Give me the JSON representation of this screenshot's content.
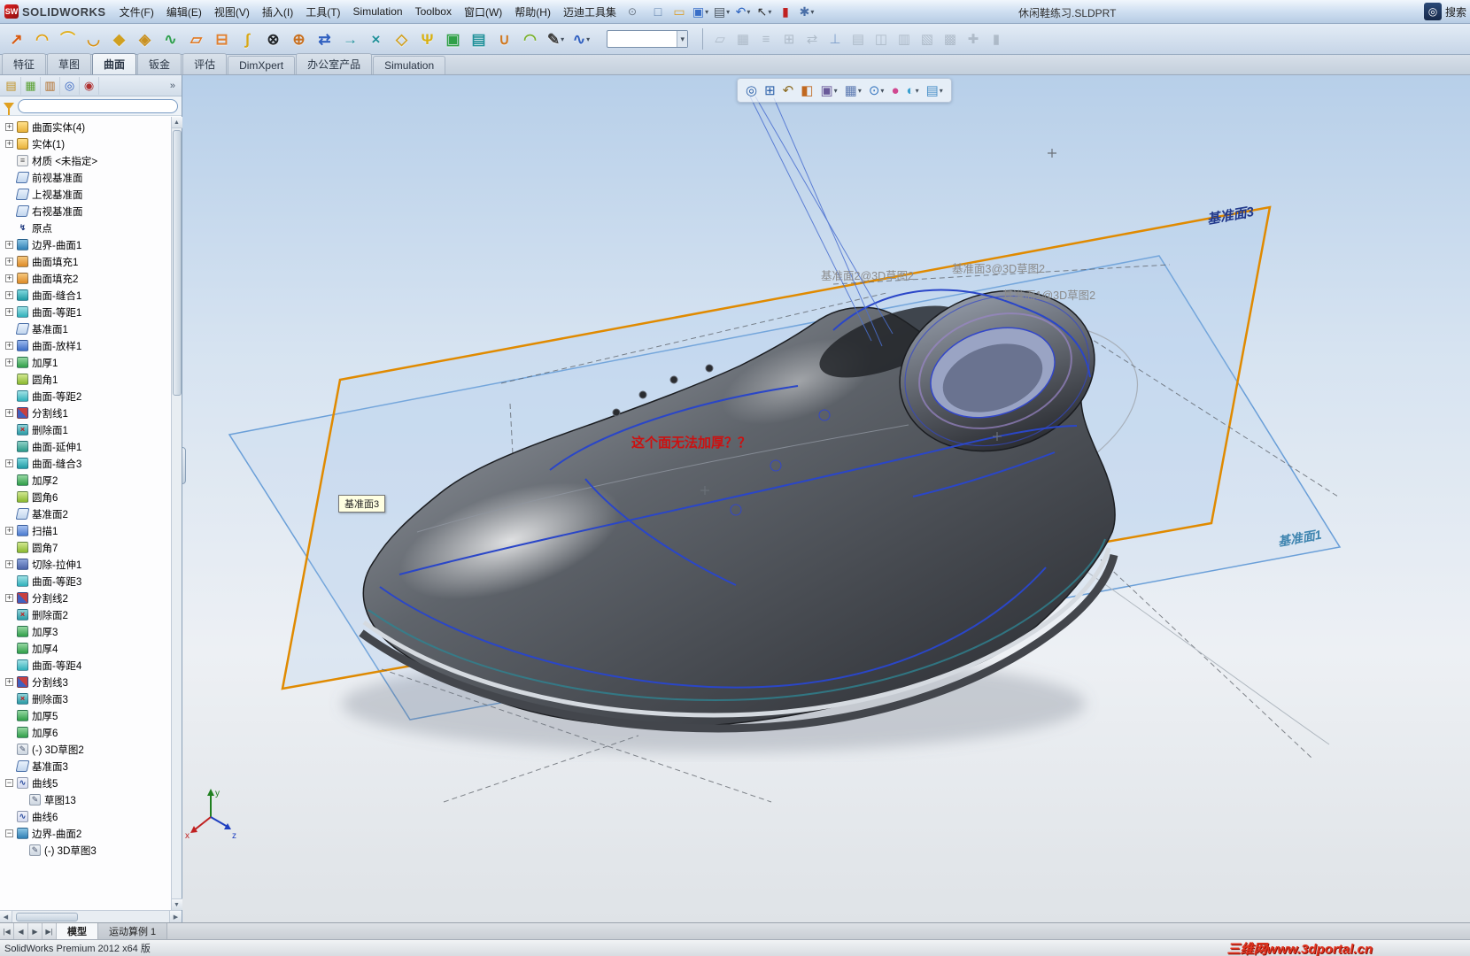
{
  "window": {
    "brand": "SOLIDWORKS",
    "title": "休闲鞋练习.SLDPRT",
    "search_label": "搜索"
  },
  "menubar": {
    "items": [
      "文件(F)",
      "编辑(E)",
      "视图(V)",
      "插入(I)",
      "工具(T)",
      "Simulation",
      "Toolbox",
      "窗口(W)",
      "帮助(H)",
      "迈迪工具集"
    ]
  },
  "quick_toolbar": {
    "icons": [
      {
        "name": "new-document-icon",
        "glyph": "□",
        "c": "#5a7ca8",
        "dd": false
      },
      {
        "name": "open-icon",
        "glyph": "▭",
        "c": "#d8a030",
        "dd": false
      },
      {
        "name": "save-icon",
        "glyph": "▣",
        "c": "#3a6fc8",
        "dd": true
      },
      {
        "name": "print-icon",
        "glyph": "▤",
        "c": "#4a5560",
        "dd": true
      },
      {
        "name": "undo-icon",
        "glyph": "↶",
        "c": "#2a62c0",
        "dd": true
      },
      {
        "name": "select-icon",
        "glyph": "↖",
        "c": "#303030",
        "dd": true
      },
      {
        "name": "rebuild-icon",
        "glyph": "▮",
        "c": "#c02020",
        "dd": false
      },
      {
        "name": "options-icon",
        "glyph": "✱",
        "c": "#4a6fa8",
        "dd": true
      }
    ]
  },
  "surface_toolbar": {
    "icons": [
      {
        "name": "surface-extrude-icon",
        "glyph": "↗",
        "c": "#d85a10",
        "dd": false
      },
      {
        "name": "surface-revolve-icon",
        "glyph": "◠",
        "c": "#e0a010",
        "dd": false
      },
      {
        "name": "surface-sweep-icon",
        "glyph": "⌒",
        "c": "#e0b020",
        "dd": false
      },
      {
        "name": "surface-loft-icon",
        "glyph": "◡",
        "c": "#d89010",
        "dd": false
      },
      {
        "name": "boundary-surface-icon",
        "glyph": "◆",
        "c": "#d0a020",
        "dd": false
      },
      {
        "name": "filled-surface-icon",
        "glyph": "◈",
        "c": "#c89020",
        "dd": false
      },
      {
        "name": "freeform-icon",
        "glyph": "∿",
        "c": "#30a050",
        "dd": false
      },
      {
        "name": "planar-surface-icon",
        "glyph": "▱",
        "c": "#e07820",
        "dd": false
      },
      {
        "name": "offset-surface-icon",
        "glyph": "⊟",
        "c": "#e08030",
        "dd": false
      },
      {
        "name": "ruled-surface-icon",
        "glyph": "∫",
        "c": "#d8a818",
        "dd": false
      },
      {
        "name": "delete-hole-icon",
        "glyph": "⊗",
        "c": "#202428",
        "dd": false
      },
      {
        "name": "replace-face-icon",
        "glyph": "⊕",
        "c": "#c87020",
        "dd": false
      },
      {
        "name": "move-face-icon",
        "glyph": "⇄",
        "c": "#3060c0",
        "dd": false
      },
      {
        "name": "extend-surface-icon",
        "glyph": "→",
        "c": "#20909a",
        "dd": false
      },
      {
        "name": "trim-surface-icon",
        "glyph": "×",
        "c": "#20909a",
        "dd": false
      },
      {
        "name": "untrim-surface-icon",
        "glyph": "◇",
        "c": "#d0a020",
        "dd": false
      },
      {
        "name": "knit-surface-icon",
        "glyph": "Ψ",
        "c": "#d8b010",
        "dd": false
      },
      {
        "name": "thicken-icon",
        "glyph": "▣",
        "c": "#30a048",
        "dd": false
      },
      {
        "name": "thickened-cut-icon",
        "glyph": "▤",
        "c": "#20909a",
        "dd": false
      },
      {
        "name": "cut-with-surface-icon",
        "glyph": "∪",
        "c": "#d07820",
        "dd": false
      },
      {
        "name": "fillet-icon",
        "glyph": "◠",
        "c": "#78b028",
        "dd": false
      },
      {
        "name": "sketch-icon",
        "glyph": "✎",
        "c": "#404040",
        "dd": true
      },
      {
        "name": "curves-icon",
        "glyph": "∿",
        "c": "#3060c0",
        "dd": true
      }
    ]
  },
  "inactive_toolbar": {
    "icons": [
      {
        "name": "inactive-tool-icon-1",
        "glyph": "▱",
        "c": "#8a97a4",
        "dd": false
      },
      {
        "name": "inactive-tool-icon-2",
        "glyph": "▦",
        "c": "#8a97a4",
        "dd": false
      },
      {
        "name": "inactive-tool-icon-3",
        "glyph": "≡",
        "c": "#8a97a4",
        "dd": false
      },
      {
        "name": "inactive-tool-icon-4",
        "glyph": "⊞",
        "c": "#8a97a4",
        "dd": false
      },
      {
        "name": "inactive-tool-icon-5",
        "glyph": "⇄",
        "c": "#8a97a4",
        "dd": false
      },
      {
        "name": "inactive-tool-icon-6",
        "glyph": "⊥",
        "c": "#2a5fa8",
        "dd": false
      },
      {
        "name": "inactive-tool-icon-7",
        "glyph": "▤",
        "c": "#8a97a4",
        "dd": false
      },
      {
        "name": "inactive-tool-icon-8",
        "glyph": "◫",
        "c": "#8a97a4",
        "dd": false
      },
      {
        "name": "inactive-tool-icon-9",
        "glyph": "▥",
        "c": "#8a97a4",
        "dd": false
      },
      {
        "name": "inactive-tool-icon-10",
        "glyph": "▧",
        "c": "#8a97a4",
        "dd": false
      },
      {
        "name": "inactive-tool-icon-11",
        "glyph": "▩",
        "c": "#8a97a4",
        "dd": false
      },
      {
        "name": "inactive-tool-icon-12",
        "glyph": "✚",
        "c": "#8a97a4",
        "dd": false
      },
      {
        "name": "inactive-tool-icon-13",
        "glyph": "▮",
        "c": "#8a97a4",
        "dd": false
      }
    ]
  },
  "command_tabs": {
    "items": [
      "特征",
      "草图",
      "曲面",
      "钣金",
      "评估",
      "DimXpert",
      "办公室产品",
      "Simulation"
    ],
    "active": "曲面"
  },
  "left_panel": {
    "tab_icons": [
      {
        "name": "featuremanager-tab-icon",
        "glyph": "▤",
        "c": "#c09020",
        "dd": false
      },
      {
        "name": "propertymanager-tab-icon",
        "glyph": "▦",
        "c": "#58a030",
        "dd": false
      },
      {
        "name": "configurationmanager-tab-icon",
        "glyph": "▥",
        "c": "#b06820",
        "dd": false
      },
      {
        "name": "dimxpertmanager-tab-icon",
        "glyph": "◎",
        "c": "#3060c0",
        "dd": false
      },
      {
        "name": "displaymanager-tab-icon",
        "glyph": "◉",
        "c": "#b03030",
        "dd": false
      }
    ],
    "chevron": "»",
    "filter_placeholder": ""
  },
  "feature_tree": {
    "items": [
      {
        "label": "曲面实体(4)",
        "icon": "folder-surface",
        "level": 0,
        "expander": "plus"
      },
      {
        "label": "实体(1)",
        "icon": "folder-solid",
        "level": 0,
        "expander": "plus"
      },
      {
        "label": "材质 <未指定>",
        "icon": "material",
        "level": 0,
        "expander": null
      },
      {
        "label": "前视基准面",
        "icon": "plane",
        "level": 0,
        "expander": null
      },
      {
        "label": "上视基准面",
        "icon": "plane",
        "level": 0,
        "expander": null
      },
      {
        "label": "右视基准面",
        "icon": "plane",
        "level": 0,
        "expander": null
      },
      {
        "label": "原点",
        "icon": "origin",
        "level": 0,
        "expander": null
      },
      {
        "label": "边界-曲面1",
        "icon": "boundary-surface",
        "level": 0,
        "expander": "plus"
      },
      {
        "label": "曲面填充1",
        "icon": "surface-fill",
        "level": 0,
        "expander": "plus"
      },
      {
        "label": "曲面填充2",
        "icon": "surface-fill",
        "level": 0,
        "expander": "plus"
      },
      {
        "label": "曲面-缝合1",
        "icon": "surface-knit",
        "level": 0,
        "expander": "plus"
      },
      {
        "label": "曲面-等距1",
        "icon": "surface-offset",
        "level": 0,
        "expander": "plus"
      },
      {
        "label": "基准面1",
        "icon": "plane",
        "level": 0,
        "expander": null
      },
      {
        "label": "曲面-放样1",
        "icon": "surface-loft",
        "level": 0,
        "expander": "plus"
      },
      {
        "label": "加厚1",
        "icon": "thicken",
        "level": 0,
        "expander": "plus"
      },
      {
        "label": "圆角1",
        "icon": "fillet",
        "level": 0,
        "expander": null
      },
      {
        "label": "曲面-等距2",
        "icon": "surface-offset",
        "level": 0,
        "expander": null
      },
      {
        "label": "分割线1",
        "icon": "split-line",
        "level": 0,
        "expander": "plus"
      },
      {
        "label": "删除面1",
        "icon": "delete-face",
        "level": 0,
        "expander": null
      },
      {
        "label": "曲面-延伸1",
        "icon": "surface-extend",
        "level": 0,
        "expander": null
      },
      {
        "label": "曲面-缝合3",
        "icon": "surface-knit",
        "level": 0,
        "expander": "plus"
      },
      {
        "label": "加厚2",
        "icon": "thicken",
        "level": 0,
        "expander": null
      },
      {
        "label": "圆角6",
        "icon": "fillet",
        "level": 0,
        "expander": null
      },
      {
        "label": "基准面2",
        "icon": "plane",
        "level": 0,
        "expander": null
      },
      {
        "label": "扫描1",
        "icon": "sweep",
        "level": 0,
        "expander": "plus"
      },
      {
        "label": "圆角7",
        "icon": "fillet",
        "level": 0,
        "expander": null
      },
      {
        "label": "切除-拉伸1",
        "icon": "cut-extrude",
        "level": 0,
        "expander": "plus"
      },
      {
        "label": "曲面-等距3",
        "icon": "surface-offset",
        "level": 0,
        "expander": null
      },
      {
        "label": "分割线2",
        "icon": "split-line",
        "level": 0,
        "expander": "plus"
      },
      {
        "label": "删除面2",
        "icon": "delete-face",
        "level": 0,
        "expander": null
      },
      {
        "label": "加厚3",
        "icon": "thicken",
        "level": 0,
        "expander": null
      },
      {
        "label": "加厚4",
        "icon": "thicken",
        "level": 0,
        "expander": null
      },
      {
        "label": "曲面-等距4",
        "icon": "surface-offset",
        "level": 0,
        "expander": null
      },
      {
        "label": "分割线3",
        "icon": "split-line",
        "level": 0,
        "expander": "plus"
      },
      {
        "label": "删除面3",
        "icon": "delete-face",
        "level": 0,
        "expander": null
      },
      {
        "label": "加厚5",
        "icon": "thicken",
        "level": 0,
        "expander": null
      },
      {
        "label": "加厚6",
        "icon": "thicken",
        "level": 0,
        "expander": null
      },
      {
        "label": "(-) 3D草图2",
        "icon": "sketch3d",
        "level": 0,
        "expander": null
      },
      {
        "label": "基准面3",
        "icon": "plane",
        "level": 0,
        "expander": null
      },
      {
        "label": "曲线5",
        "icon": "curve",
        "level": 0,
        "expander": "minus"
      },
      {
        "label": "草图13",
        "icon": "sketch",
        "level": 1,
        "expander": null
      },
      {
        "label": "曲线6",
        "icon": "curve",
        "level": 0,
        "expander": null
      },
      {
        "label": "边界-曲面2",
        "icon": "boundary-surface",
        "level": 0,
        "expander": "minus"
      },
      {
        "label": "(-) 3D草图3",
        "icon": "sketch3d",
        "level": 1,
        "expander": null
      }
    ]
  },
  "viewport": {
    "heads_up_icons": [
      {
        "name": "zoom-fit-icon",
        "glyph": "◎",
        "c": "#2a5fa8",
        "dd": false
      },
      {
        "name": "zoom-area-icon",
        "glyph": "⊞",
        "c": "#2a5fa8",
        "dd": false
      },
      {
        "name": "previous-view-icon",
        "glyph": "↶",
        "c": "#8a6a20",
        "dd": false
      },
      {
        "name": "section-view-icon",
        "glyph": "◧",
        "c": "#c06820",
        "dd": false
      },
      {
        "name": "view-orientation-icon",
        "glyph": "▣",
        "c": "#6a5a9a",
        "dd": true
      },
      {
        "name": "display-style-icon",
        "glyph": "▦",
        "c": "#5a78b0",
        "dd": true
      },
      {
        "name": "hide-show-items-icon",
        "glyph": "⊙",
        "c": "#3a78c0",
        "dd": true
      },
      {
        "name": "edit-appearance-icon",
        "glyph": "●",
        "c": "#d04890",
        "dd": false
      },
      {
        "name": "apply-scene-icon",
        "glyph": "◐",
        "c": "#3aa0d0",
        "dd": true
      },
      {
        "name": "view-settings-icon",
        "glyph": "▤",
        "c": "#4a90c8",
        "dd": true
      }
    ],
    "labels": {
      "plane3": "基准面3",
      "plane1": "基准面1",
      "tooltip": "基准面3",
      "warning": "这个面无法加厚？？",
      "sk1": "基准面2@3D草图2",
      "sk2": "基准面3@3D草图2",
      "sk3": "基准面1@3D草图2"
    },
    "triad": {
      "x": "x",
      "y": "y",
      "z": "z"
    }
  },
  "bottom_tabs": {
    "nav": [
      "|◀",
      "◀",
      "▶",
      "▶|"
    ],
    "items": [
      "模型",
      "运动算例 1"
    ],
    "active": "模型"
  },
  "status_bar": {
    "text": "SolidWorks Premium 2012 x64 版",
    "watermark": "三维网www.3dportal.cn"
  },
  "colors": {
    "accent_orange": "#e08a00",
    "plane_blue": "#6a9fd8",
    "selection_blue": "#2a46c8",
    "warning_red": "#cc1111"
  }
}
